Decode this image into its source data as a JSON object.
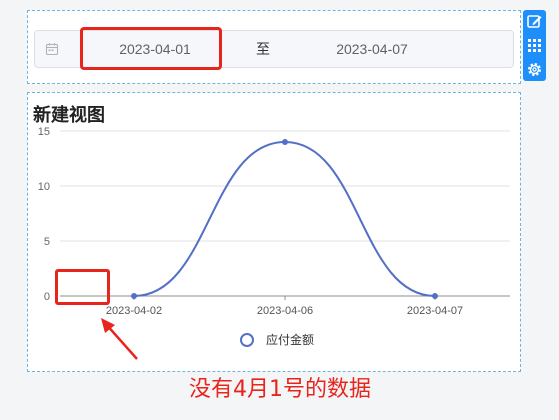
{
  "filter": {
    "start_date": "2023-04-01",
    "separator": "至",
    "end_date": "2023-04-07"
  },
  "toolbar": {
    "icons": [
      "edit-icon",
      "grid-icon",
      "settings-icon"
    ]
  },
  "view": {
    "title": "新建视图"
  },
  "chart_data": {
    "type": "line",
    "categories": [
      "2023-04-02",
      "2023-04-06",
      "2023-04-07"
    ],
    "series": [
      {
        "name": "应付金额",
        "values": [
          0,
          14,
          0
        ],
        "color": "#5470c6"
      }
    ],
    "yticks": [
      0,
      5,
      10,
      15
    ],
    "ylim": [
      0,
      15
    ],
    "smooth": true,
    "legend": "bottom-center",
    "grid": true
  },
  "annotation": {
    "note": "没有4月1号的数据",
    "color": "#e8251d"
  }
}
